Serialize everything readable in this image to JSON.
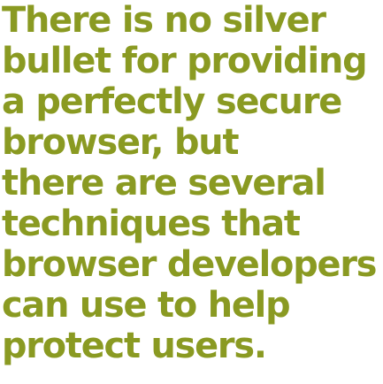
{
  "quote": {
    "lines": [
      "There is no silver",
      "bullet for providing",
      "a perfectly secure",
      "browser, but",
      "there are several",
      "techniques that",
      "browser developers",
      "can use to help",
      "protect users."
    ],
    "color": "#8a9a22"
  }
}
